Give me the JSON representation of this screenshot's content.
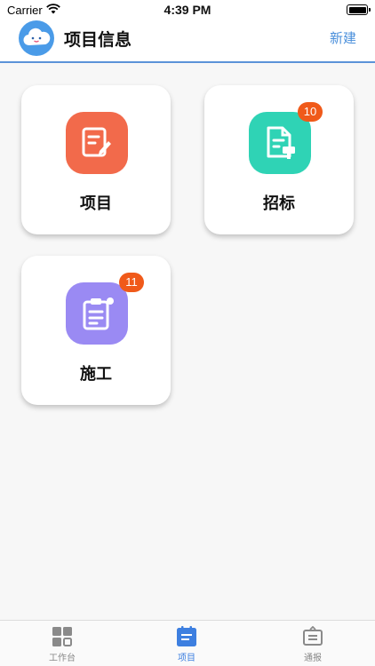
{
  "status_bar": {
    "carrier": "Carrier",
    "time": "4:39 PM"
  },
  "header": {
    "title": "项目信息",
    "new_label": "新建"
  },
  "cards": [
    {
      "label": "项目",
      "icon": "project-edit-icon",
      "color": "#f26a4b",
      "badge": ""
    },
    {
      "label": "招标",
      "icon": "bidding-document-icon",
      "color": "#2fd3b5",
      "badge": "10"
    },
    {
      "label": "施工",
      "icon": "construction-clipboard-icon",
      "color": "#9a8af3",
      "badge": "11"
    }
  ],
  "tab_bar": {
    "active_color": "#3d7fe0",
    "items": [
      {
        "label": "工作台",
        "icon": "grid-icon",
        "active": false
      },
      {
        "label": "项目",
        "icon": "document-icon",
        "active": true
      },
      {
        "label": "通报",
        "icon": "notice-board-icon",
        "active": false
      }
    ]
  },
  "colors": {
    "badge": "#f05a1a",
    "accent": "#4a8fdb"
  }
}
